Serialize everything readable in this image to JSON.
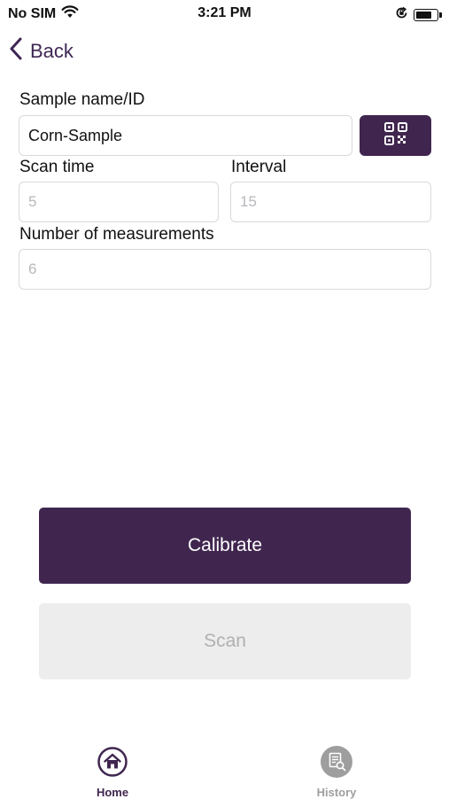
{
  "status_bar": {
    "carrier": "No SIM",
    "time": "3:21 PM"
  },
  "nav": {
    "back_label": "Back"
  },
  "form": {
    "sample_label": "Sample name/ID",
    "sample_value": "Corn-Sample",
    "scan_time_label": "Scan time",
    "scan_time_placeholder": "5",
    "interval_label": "Interval",
    "interval_placeholder": "15",
    "measurements_label": "Number of measurements",
    "measurements_placeholder": "6"
  },
  "actions": {
    "calibrate_label": "Calibrate",
    "scan_label": "Scan"
  },
  "tabs": [
    {
      "label": "Home",
      "icon": "home-icon",
      "active": true
    },
    {
      "label": "History",
      "icon": "history-icon",
      "active": false
    }
  ],
  "colors": {
    "accent": "#40264f",
    "disabled_bg": "#ededed",
    "disabled_text": "#b0b0b0",
    "inactive_tab": "#9e9e9e"
  }
}
